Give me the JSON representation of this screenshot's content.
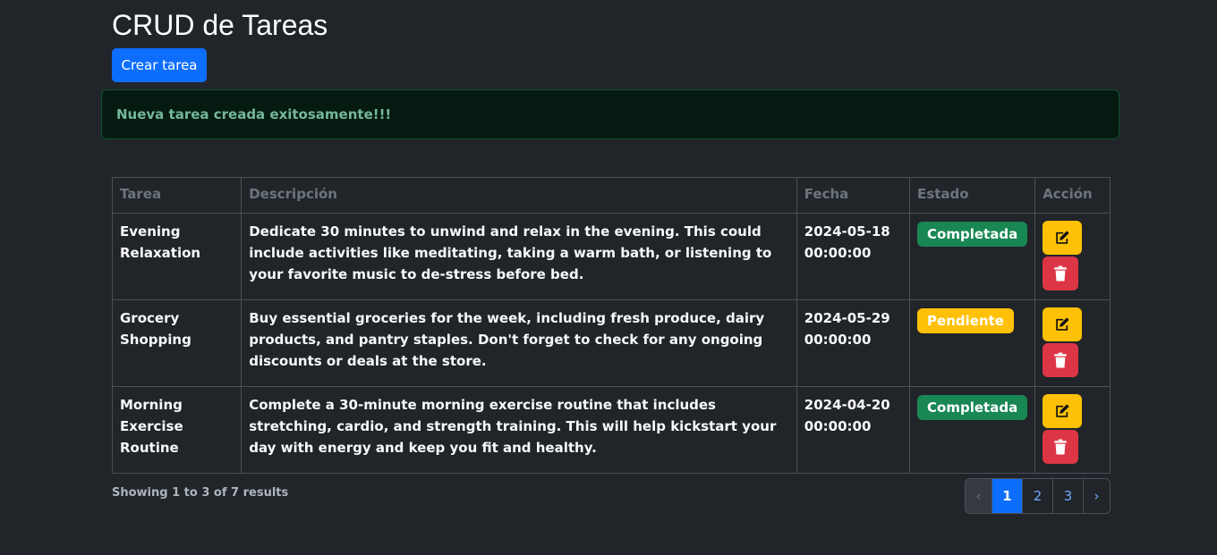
{
  "page": {
    "title": "CRUD de Tareas"
  },
  "toolbar": {
    "create_label": "Crear tarea"
  },
  "alert": {
    "message": "Nueva tarea creada exitosamente!!!",
    "color": "#75b798"
  },
  "table": {
    "headers": [
      "Tarea",
      "Descripción",
      "Fecha",
      "Estado",
      "Acción"
    ],
    "rows": [
      {
        "task": "Evening Relaxation",
        "description": "Dedicate 30 minutes to unwind and relax in the evening. This could include activities like meditating, taking a warm bath, or listening to your favorite music to de-stress before bed.",
        "date": "2024-05-18 00:00:00",
        "status": "Completada",
        "status_color": "#198754"
      },
      {
        "task": "Grocery Shopping",
        "description": "Buy essential groceries for the week, including fresh produce, dairy products, and pantry staples. Don't forget to check for any ongoing discounts or deals at the store.",
        "date": "2024-05-29 00:00:00",
        "status": "Pendiente",
        "status_color": "#ffc107"
      },
      {
        "task": "Morning Exercise Routine",
        "description": "Complete a 30-minute morning exercise routine that includes stretching, cardio, and strength training. This will help kickstart your day with energy and keep you fit and healthy.",
        "date": "2024-04-20 00:00:00",
        "status": "Completada",
        "status_color": "#198754"
      }
    ],
    "actions": {
      "edit_icon": "edit-icon",
      "delete_icon": "trash-icon"
    }
  },
  "footer": {
    "summary": "Showing 1 to 3 of 7 results"
  },
  "pagination": {
    "prev": "‹",
    "pages": [
      "1",
      "2",
      "3"
    ],
    "current": "1",
    "next": "›"
  }
}
